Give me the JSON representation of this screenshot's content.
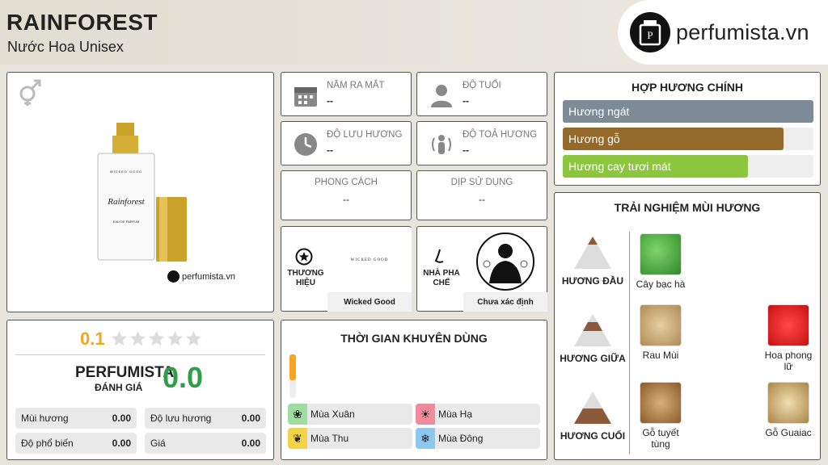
{
  "header": {
    "title": "RAINFOREST",
    "subtitle": "Nước Hoa Unisex",
    "logo_text": "perfumista.vn"
  },
  "product": {
    "bottle_label": "Rainforest",
    "bottle_brand": "WICKED GOOD",
    "bottle_type": "EAU DE PARFUM",
    "watermark": "perfumista.vn"
  },
  "info": {
    "release": {
      "label": "Năm ra mắt",
      "value": "--"
    },
    "age": {
      "label": "Độ tuổi",
      "value": "--"
    },
    "longevity": {
      "label": "Độ lưu hương",
      "value": "--"
    },
    "sillage": {
      "label": "Độ toả hương",
      "value": "--"
    },
    "style": {
      "label": "Phong cách",
      "value": "--"
    },
    "occasion": {
      "label": "Dịp sử dụng",
      "value": "--"
    },
    "brand": {
      "label_line1": "THƯƠNG",
      "label_line2": "HIỆU",
      "name": "Wicked Good",
      "logo_text": "WICKED GOOD"
    },
    "perfumer": {
      "label_line1": "NHÀ PHA",
      "label_line2": "CHẾ",
      "name": "Chưa xác định"
    }
  },
  "accords": {
    "title": "HỢP HƯƠNG CHÍNH",
    "items": [
      {
        "label": "Hương ngát",
        "fraction": 1.0,
        "color": "#7d8b99"
      },
      {
        "label": "Hương gỗ",
        "fraction": 0.88,
        "color": "#94692a"
      },
      {
        "label": "Hương cay tươi mát",
        "fraction": 0.74,
        "color": "#8cc63f"
      }
    ]
  },
  "rating": {
    "score": "0.1",
    "stars_filled": 0,
    "stars_total": 5,
    "brand_label": "PERFUMISTA",
    "sub_label": "ĐÁNH GIÁ",
    "perfumista_score": "0.0",
    "items": [
      {
        "label": "Mùi hương",
        "value": "0.00"
      },
      {
        "label": "Độ lưu hương",
        "value": "0.00"
      },
      {
        "label": "Độ phổ biến",
        "value": "0.00"
      },
      {
        "label": "Giá",
        "value": "0.00"
      }
    ]
  },
  "usage": {
    "title": "THỜI GIAN KHUYÊN DÙNG",
    "day_fraction": 0.6,
    "seasons": [
      {
        "label": "Mùa Xuân",
        "color": "#9fdc9f"
      },
      {
        "label": "Mùa Hạ",
        "color": "#f28b9b"
      },
      {
        "label": "Mùa Thu",
        "color": "#f3d34a"
      },
      {
        "label": "Mùa Đông",
        "color": "#8cc8ef"
      }
    ]
  },
  "notes": {
    "title": "TRẢI NGHIỆM MÙI HƯƠNG",
    "top": {
      "label": "HƯƠNG ĐẦU",
      "items": [
        "Cây bạc hà"
      ]
    },
    "middle": {
      "label": "HƯƠNG GIỮA",
      "items": [
        "Rau Mùi",
        "Hoa phong lữ"
      ]
    },
    "base": {
      "label": "HƯƠNG CUỐI",
      "items": [
        "Gỗ tuyết tùng",
        "Gỗ Guaiac"
      ]
    }
  },
  "colors": {
    "accent_orange": "#f4a623",
    "score_green": "#2e9e48"
  }
}
